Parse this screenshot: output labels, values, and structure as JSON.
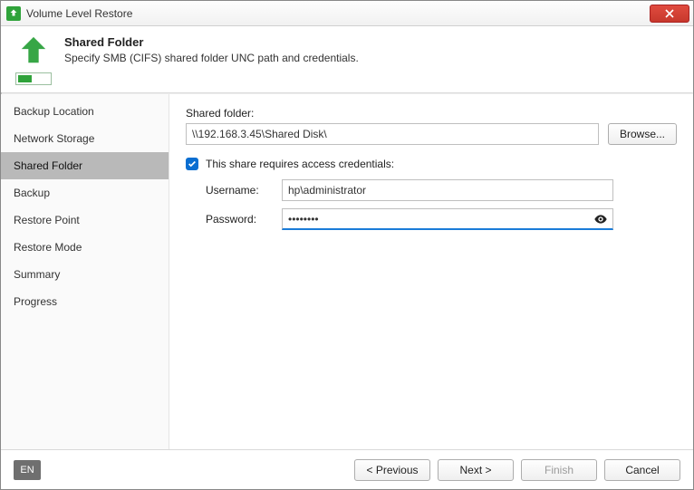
{
  "window": {
    "title": "Volume Level Restore"
  },
  "header": {
    "title": "Shared Folder",
    "subtitle": "Specify SMB (CIFS) shared folder UNC path and credentials."
  },
  "sidebar": {
    "items": [
      {
        "label": "Backup Location"
      },
      {
        "label": "Network Storage"
      },
      {
        "label": "Shared Folder"
      },
      {
        "label": "Backup"
      },
      {
        "label": "Restore Point"
      },
      {
        "label": "Restore Mode"
      },
      {
        "label": "Summary"
      },
      {
        "label": "Progress"
      }
    ],
    "active_index": 2
  },
  "form": {
    "shared_folder_label": "Shared folder:",
    "shared_folder_value": "\\\\192.168.3.45\\Shared Disk\\",
    "browse_label": "Browse...",
    "requires_creds_label": "This share requires access credentials:",
    "requires_creds_checked": true,
    "username_label": "Username:",
    "username_value": "hp\\administrator",
    "password_label": "Password:",
    "password_value": "••••••••"
  },
  "footer": {
    "lang": "EN",
    "previous": "< Previous",
    "next": "Next >",
    "finish": "Finish",
    "cancel": "Cancel"
  }
}
